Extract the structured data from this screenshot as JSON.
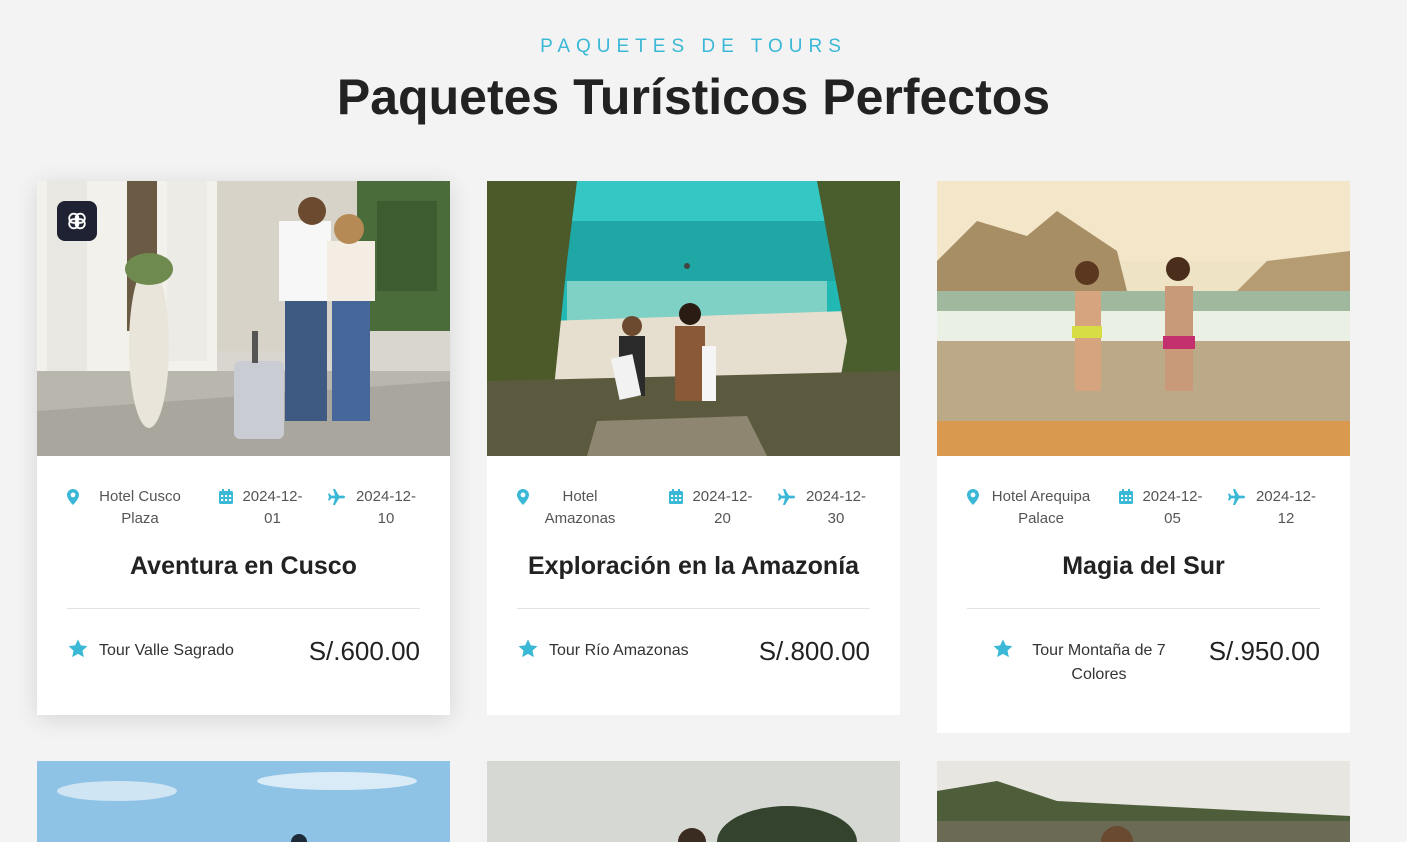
{
  "header": {
    "eyebrow": "PAQUETES DE TOURS",
    "title": "Paquetes Turísticos Perfectos"
  },
  "icons": {
    "badge": "brain-icon",
    "hotel": "map-pin-icon",
    "start": "calendar-icon",
    "end": "plane-icon",
    "tour": "star-icon"
  },
  "colors": {
    "accent": "#3bb8d6",
    "badge_bg": "#1e2233",
    "background": "#f3f3f3"
  },
  "packages": [
    {
      "hotel": "Hotel Cusco Plaza",
      "start_date": "2024-12-01",
      "end_date": "2024-12-10",
      "title": "Aventura en Cusco",
      "tour": "Tour Valle Sagrado",
      "price": "S/.600.00"
    },
    {
      "hotel": "Hotel Amazonas",
      "start_date": "2024-12-20",
      "end_date": "2024-12-30",
      "title": "Exploración en la Amazonía",
      "tour": "Tour Río Amazonas",
      "price": "S/.800.00"
    },
    {
      "hotel": "Hotel Arequipa Palace",
      "start_date": "2024-12-05",
      "end_date": "2024-12-12",
      "title": "Magia del Sur",
      "tour": "Tour Montaña de 7 Colores",
      "price": "S/.950.00"
    }
  ]
}
